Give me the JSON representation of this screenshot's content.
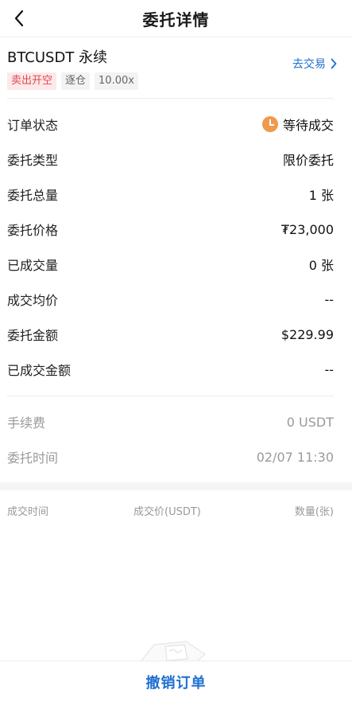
{
  "header": {
    "title": "委托详情",
    "back_icon": "chevron-left-icon"
  },
  "order": {
    "symbol": "BTCUSDT 永续",
    "tags": {
      "side": "卖出开空",
      "margin": "逐仓",
      "leverage": "10.00x"
    },
    "go_trade": "去交易",
    "colors": {
      "sell": "#e0474c",
      "link": "#1f6fd1",
      "pending": "#f09a4e"
    }
  },
  "details": [
    {
      "label": "订单状态",
      "value": "等待成交",
      "icon": "clock-icon"
    },
    {
      "label": "委托类型",
      "value": "限价委托"
    },
    {
      "label": "委托总量",
      "value": "1 张"
    },
    {
      "label": "委托价格",
      "value": "₮23,000"
    },
    {
      "label": "已成交量",
      "value": "0 张"
    },
    {
      "label": "成交均价",
      "value": "--"
    },
    {
      "label": "委托金额",
      "value": "$229.99"
    },
    {
      "label": "已成交金额",
      "value": "--"
    }
  ],
  "fees": [
    {
      "label": "手续费",
      "value": "0 USDT"
    },
    {
      "label": "委托时间",
      "value": "02/07 11:30"
    }
  ],
  "fills_table": {
    "columns": [
      "成交时间",
      "成交价(USDT)",
      "数量(张)"
    ]
  },
  "footer": {
    "cancel_label": "撤销订单"
  }
}
